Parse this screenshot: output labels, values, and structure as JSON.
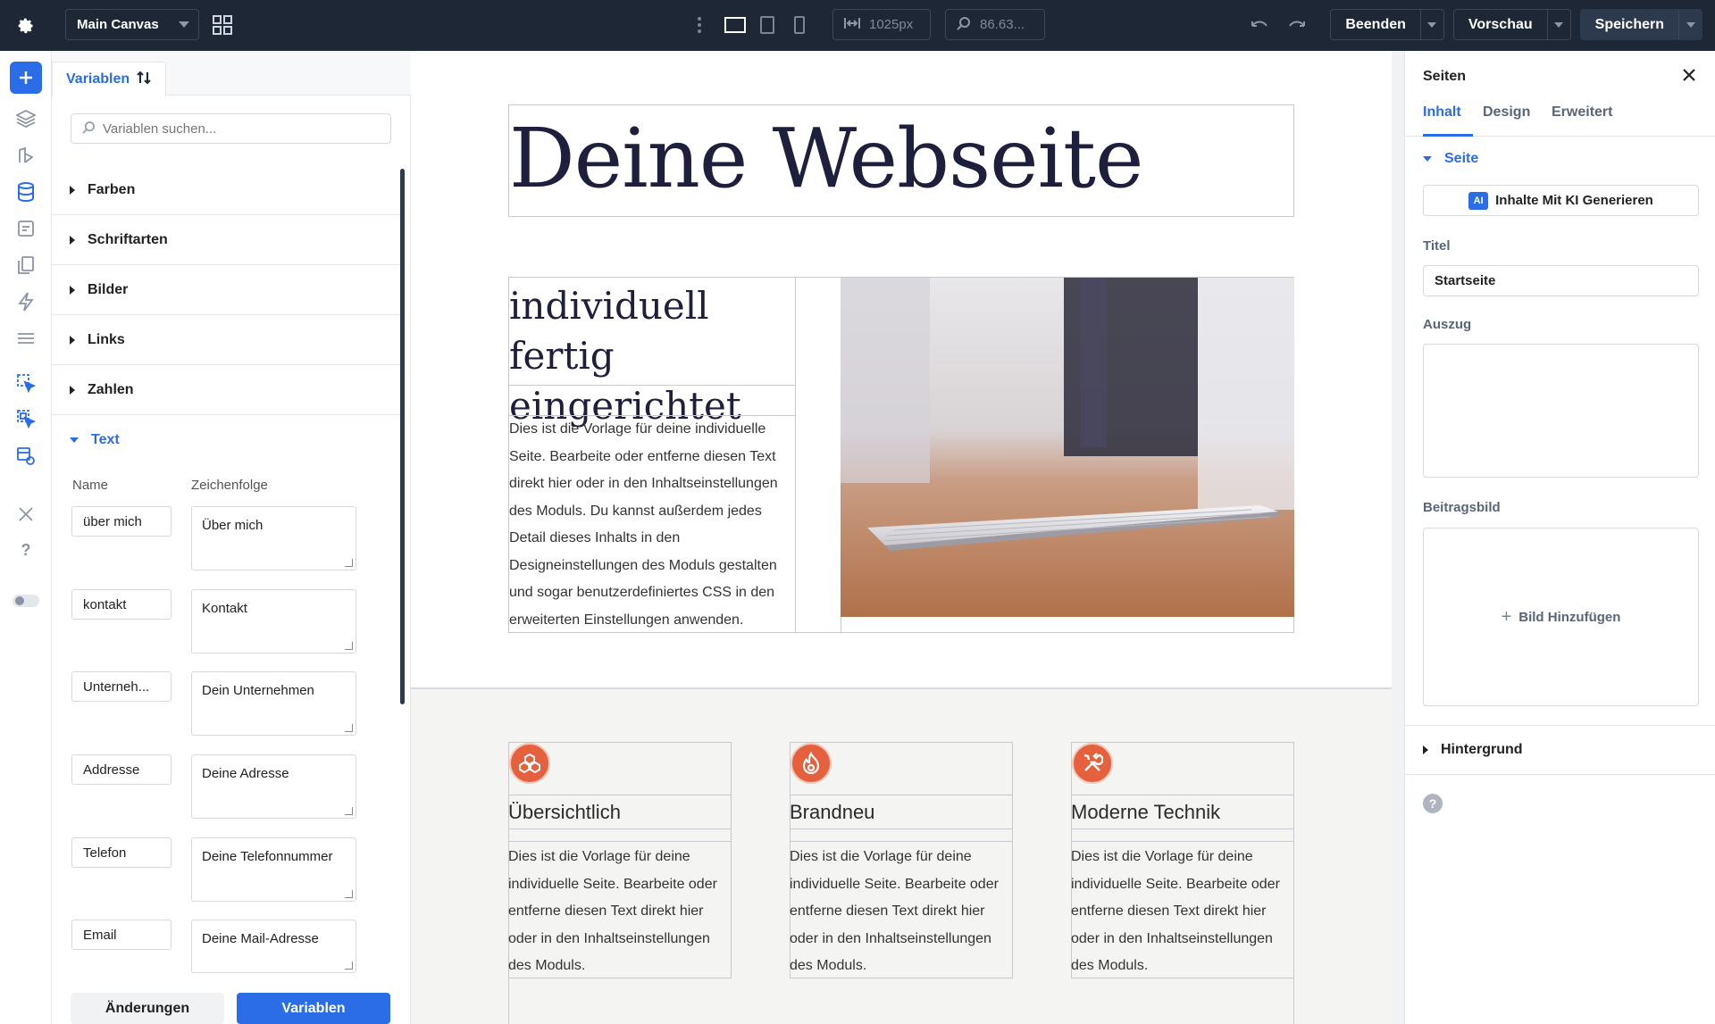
{
  "topbar": {
    "canvas_select": "Main Canvas",
    "width_value": "1025px",
    "zoom_value": "86.63...",
    "beenden": "Beenden",
    "vorschau": "Vorschau",
    "speichern": "Speichern"
  },
  "variables": {
    "tab_label": "Variablen",
    "search_placeholder": "Variablen suchen...",
    "sections": [
      "Farben",
      "Schriftarten",
      "Bilder",
      "Links",
      "Zahlen"
    ],
    "open_section": "Text",
    "col_name": "Name",
    "col_value": "Zeichenfolge",
    "rows": [
      {
        "name": "über mich",
        "value": "Über mich"
      },
      {
        "name": "kontakt",
        "value": "Kontakt"
      },
      {
        "name": "Unterneh...",
        "value": "Dein Unternehmen"
      },
      {
        "name": "Addresse",
        "value": "Deine Adresse"
      },
      {
        "name": "Telefon",
        "value": "Deine Telefonnummer"
      },
      {
        "name": "Email",
        "value": "Deine Mail-Adresse"
      }
    ],
    "footer_changes": "Änderungen",
    "footer_variables": "Variablen"
  },
  "canvas": {
    "hero_title": "Deine Webseite",
    "intro_heading": "individuell fertig eingerichtet",
    "intro_text": "Dies ist die Vorlage für deine individuelle Seite. Bearbeite oder entferne diesen Text direkt hier oder in den Inhaltseinstellungen des Moduls. Du kannst außerdem jedes Detail dieses Inhalts in den Designeinstellungen des Moduls gestalten und sogar benutzerdefiniertes CSS in den erweiterten Einstellungen anwenden.",
    "features": [
      {
        "title": "Übersichtlich",
        "icon": "cubes-icon",
        "text": "Dies ist die Vorlage für deine individuelle Seite. Bearbeite oder entferne diesen Text direkt hier oder in den Inhaltseinstellungen des Moduls."
      },
      {
        "title": "Brandneu",
        "icon": "flame-icon",
        "text": "Dies ist die Vorlage für deine individuelle Seite. Bearbeite oder entferne diesen Text direkt hier oder in den Inhaltseinstellungen des Moduls."
      },
      {
        "title": "Moderne Technik",
        "icon": "tools-icon",
        "text": "Dies ist die Vorlage für deine individuelle Seite. Bearbeite oder entferne diesen Text direkt hier oder in den Inhaltseinstellungen des Moduls."
      }
    ],
    "accent": "#e5613e"
  },
  "settings": {
    "title": "Seiten",
    "tabs": [
      "Inhalt",
      "Design",
      "Erweitert"
    ],
    "section": "Seite",
    "ai_badge": "AI",
    "ai_button": "Inhalte Mit KI Generieren",
    "label_title": "Titel",
    "title_value": "Startseite",
    "label_excerpt": "Auszug",
    "label_image": "Beitragsbild",
    "add_image": "Bild Hinzufügen",
    "background": "Hintergrund",
    "help": "?"
  },
  "colors": {
    "topbar": "#1e2735",
    "primary": "#2b6de6"
  }
}
